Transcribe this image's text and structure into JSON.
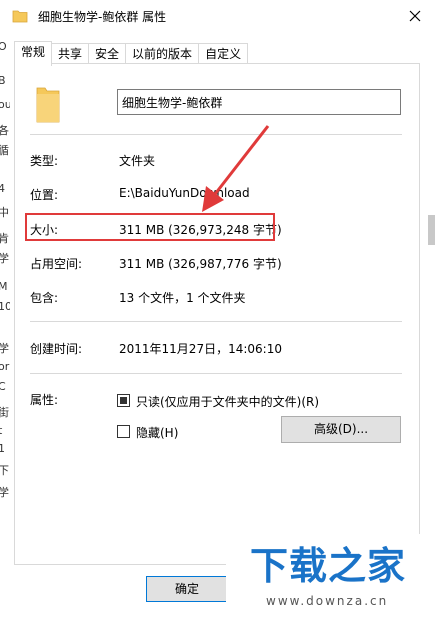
{
  "window": {
    "title": "细胞生物学-鲍依群 属性"
  },
  "background_strip": [
    "O",
    "B",
    "ou",
    "各",
    "循",
    "4",
    "中",
    "肯",
    "学",
    "M",
    "10",
    "学",
    "or",
    "C",
    "街",
    "t",
    "1",
    "下",
    "学"
  ],
  "tabs": [
    {
      "label": "常规",
      "active": true
    },
    {
      "label": "共享",
      "active": false
    },
    {
      "label": "安全",
      "active": false
    },
    {
      "label": "以前的版本",
      "active": false
    },
    {
      "label": "自定义",
      "active": false
    }
  ],
  "general": {
    "name_value": "细胞生物学-鲍依群",
    "type_label": "类型:",
    "type_value": "文件夹",
    "location_label": "位置:",
    "location_value": "E:\\BaiduYunDownload",
    "size_label": "大小:",
    "size_value": "311 MB (326,973,248 字节)",
    "disk_size_label": "占用空间:",
    "disk_size_value": "311 MB (326,987,776 字节)",
    "contains_label": "包含:",
    "contains_value": "13 个文件，1 个文件夹",
    "created_label": "创建时间:",
    "created_value": "2011年11月27日，14:06:10",
    "attributes_label": "属性:",
    "readonly_label": "只读(仅应用于文件夹中的文件)(R)",
    "readonly_checked": true,
    "hidden_label": "隐藏(H)",
    "hidden_checked": false,
    "advanced_button": "高级(D)..."
  },
  "footer": {
    "ok_button": "确定"
  },
  "watermark": {
    "main": "下载之家",
    "sub": "www.downza.cn"
  },
  "colors": {
    "highlight": "#e03a3a",
    "folder": "#f5c85a",
    "watermark": "#1a73c8"
  }
}
